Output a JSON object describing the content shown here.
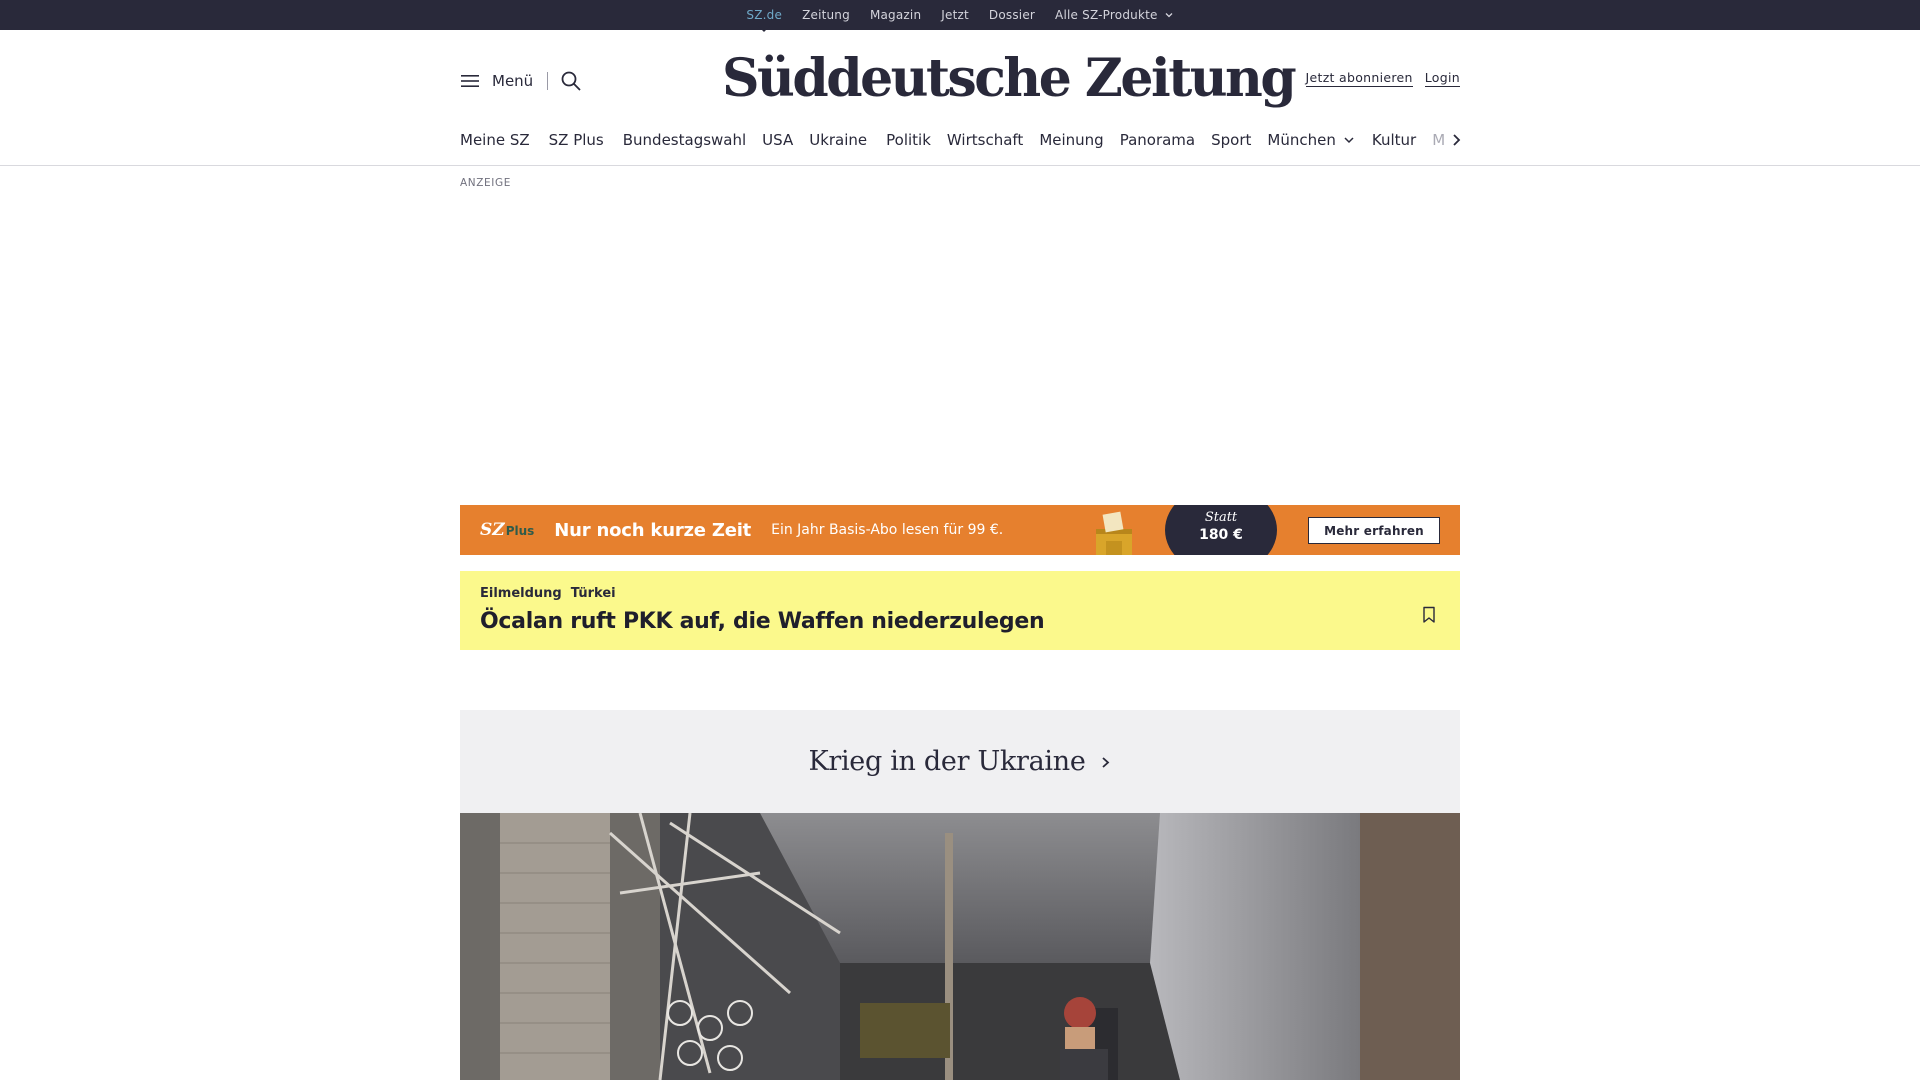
{
  "topbar": {
    "items": [
      {
        "label": "SZ.de"
      },
      {
        "label": "Zeitung"
      },
      {
        "label": "Magazin"
      },
      {
        "label": "Jetzt"
      },
      {
        "label": "Dossier"
      },
      {
        "label": "Alle SZ-Produkte"
      }
    ]
  },
  "header": {
    "menu_label": "Menü",
    "logo": "Süddeutsche Zeitung",
    "subscribe_label": "Jetzt abonnieren",
    "login_label": "Login"
  },
  "nav": {
    "items": [
      {
        "label": "Meine SZ"
      },
      {
        "label": "SZ Plus"
      },
      {
        "label": "Bundestagswahl"
      },
      {
        "label": "USA"
      },
      {
        "label": "Ukraine"
      },
      {
        "label": "Politik"
      },
      {
        "label": "Wirtschaft"
      },
      {
        "label": "Meinung"
      },
      {
        "label": "Panorama"
      },
      {
        "label": "Sport"
      },
      {
        "label": "München"
      },
      {
        "label": "Kultur"
      },
      {
        "label": "M"
      }
    ]
  },
  "ad": {
    "label": "ANZEIGE"
  },
  "promo": {
    "brand": "SZ",
    "brand_plus": "Plus",
    "headline": "Nur noch kurze Zeit",
    "subline": "Ein Jahr Basis-Abo lesen für 99 €.",
    "statt": "Statt",
    "old_price": "180 €",
    "cta": "Mehr erfahren"
  },
  "breaking": {
    "kicker": "Eilmeldung",
    "topic": "Türkei",
    "title": "Öcalan ruft PKK auf, die Waffen niederzulegen"
  },
  "section": {
    "title": "Krieg in der Ukraine"
  },
  "colors": {
    "topbar_bg": "#29293a",
    "active_link": "#6fa9c9",
    "promo_bg": "#e6802e",
    "breaking_bg": "#fbf98c",
    "section_bg": "#f0f0f2"
  }
}
